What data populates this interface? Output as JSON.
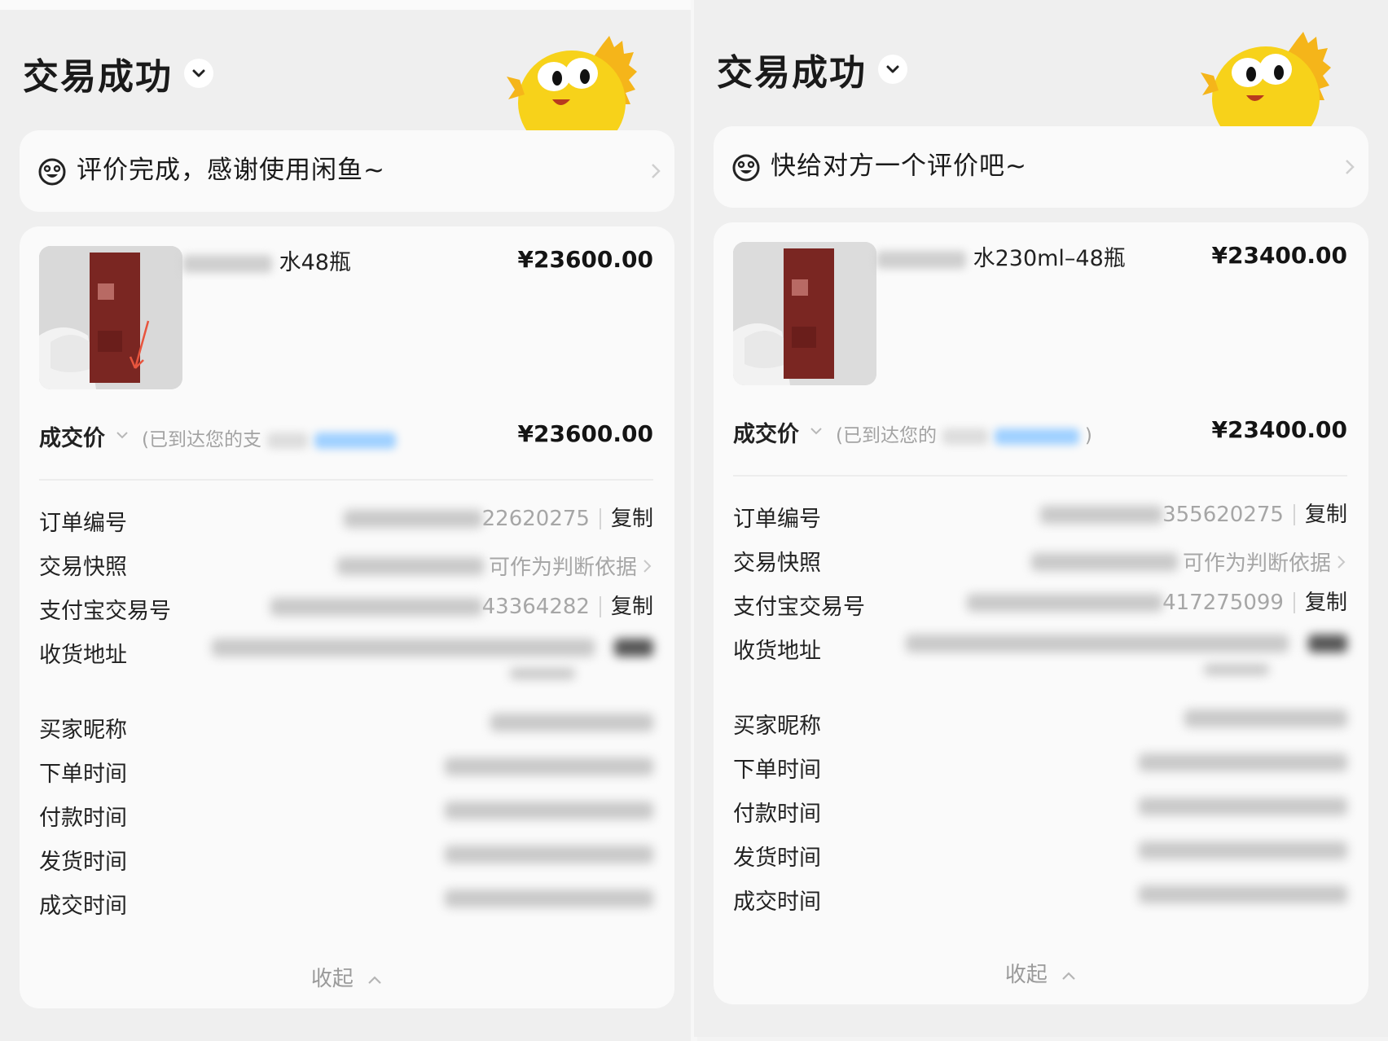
{
  "panels": [
    {
      "status_title": "交易成功",
      "review_text": "评价完成，感谢使用闲鱼~",
      "item_title_visible": "水48瓶",
      "item_price": "¥23600.00",
      "deal_label": "成交价",
      "deal_note_visible": "(已到达您的支",
      "deal_price": "¥23600.00",
      "rows": [
        {
          "label": "订单编号",
          "value_visible": "22620275",
          "action": "复制"
        },
        {
          "label": "交易快照",
          "value_visible": "可作为判断依据"
        },
        {
          "label": "支付宝交易号",
          "value_visible": "43364282",
          "action": "复制"
        },
        {
          "label": "收货地址"
        },
        {
          "label": "买家昵称"
        },
        {
          "label": "下单时间"
        },
        {
          "label": "付款时间"
        },
        {
          "label": "发货时间"
        },
        {
          "label": "成交时间"
        }
      ],
      "collapse_label": "收起"
    },
    {
      "status_title": "交易成功",
      "review_text": "快给对方一个评价吧~",
      "item_title_visible": "水230ml–48瓶",
      "item_price": "¥23400.00",
      "deal_label": "成交价",
      "deal_note_visible": "(已到达您的",
      "deal_note_end": ")",
      "deal_price": "¥23400.00",
      "rows": [
        {
          "label": "订单编号",
          "value_visible": "355620275",
          "action": "复制"
        },
        {
          "label": "交易快照",
          "value_visible": "可作为判断依据"
        },
        {
          "label": "支付宝交易号",
          "value_visible": "417275099",
          "action": "复制"
        },
        {
          "label": "收货地址"
        },
        {
          "label": "买家昵称"
        },
        {
          "label": "下单时间"
        },
        {
          "label": "付款时间"
        },
        {
          "label": "发货时间"
        },
        {
          "label": "成交时间"
        }
      ],
      "collapse_label": "收起"
    }
  ],
  "colors": {
    "page_bg": "#efefef",
    "card_bg": "#fafafa",
    "mascot_yellow": "#f7d21a",
    "product_box": "#7a2622"
  },
  "icons": {
    "status_chevron": "chevron-down-icon",
    "review": "smiley-icon",
    "review_arrow": "chevron-right-icon",
    "snapshot_arrow": "chevron-right-icon",
    "collapse": "chevron-up-icon",
    "mascot": "fish-mascot-icon"
  }
}
